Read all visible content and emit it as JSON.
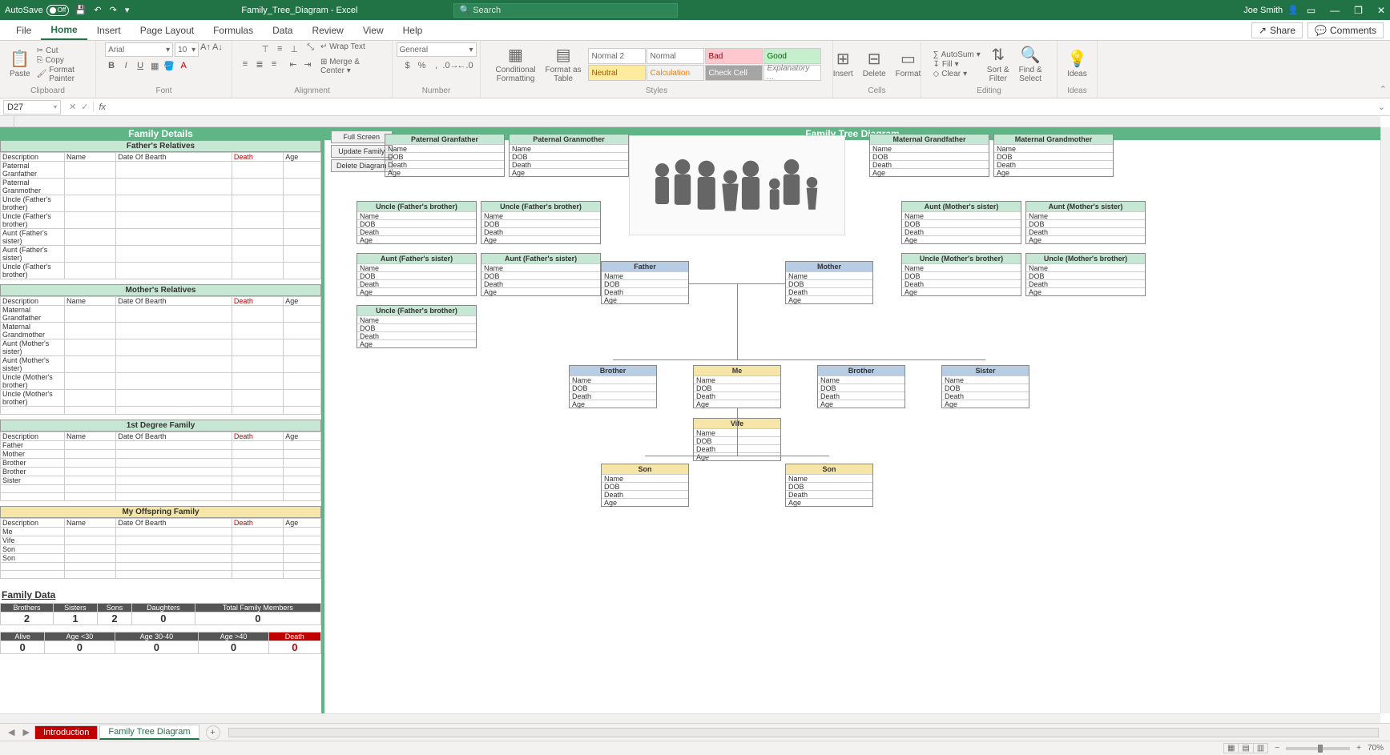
{
  "titlebar": {
    "autosave_label": "AutoSave",
    "autosave_state": "Off",
    "doc_title": "Family_Tree_Diagram - Excel",
    "search_placeholder": "Search",
    "user_name": "Joe Smith"
  },
  "menu": {
    "tabs": [
      "File",
      "Home",
      "Insert",
      "Page Layout",
      "Formulas",
      "Data",
      "Review",
      "View",
      "Help"
    ],
    "active": "Home",
    "share": "Share",
    "comments": "Comments"
  },
  "ribbon": {
    "clipboard": {
      "label": "Clipboard",
      "paste": "Paste",
      "cut": "Cut",
      "copy": "Copy",
      "format_painter": "Format Painter"
    },
    "font": {
      "label": "Font",
      "name": "Arial",
      "size": "10"
    },
    "alignment": {
      "label": "Alignment",
      "wrap": "Wrap Text",
      "merge": "Merge & Center"
    },
    "number": {
      "label": "Number",
      "format": "General"
    },
    "styles": {
      "label": "Styles",
      "cond": "Conditional\nFormatting",
      "table": "Format as\nTable",
      "cells": [
        "Normal 2",
        "Normal",
        "Bad",
        "Good",
        "Neutral",
        "Calculation",
        "Check Cell",
        "Explanatory ..."
      ]
    },
    "cells": {
      "label": "Cells",
      "insert": "Insert",
      "delete": "Delete",
      "format": "Format"
    },
    "editing": {
      "label": "Editing",
      "autosum": "AutoSum",
      "fill": "Fill",
      "clear": "Clear",
      "sort": "Sort &\nFilter",
      "find": "Find &\nSelect"
    },
    "ideas": {
      "label": "Ideas",
      "btn": "Ideas"
    }
  },
  "formula": {
    "cell_ref": "D27",
    "value": ""
  },
  "leftpanel": {
    "title": "Family Details",
    "cols": {
      "desc": "Description",
      "name": "Name",
      "dob": "Date Of Bearth",
      "death": "Death",
      "age": "Age"
    },
    "father_hdr": "Father's Relatives",
    "father_rows": [
      "Paternal Granfather",
      "Paternal Granmother",
      "Uncle (Father's brother)",
      "Uncle (Father's brother)",
      "Aunt (Father's sister)",
      "Aunt (Father's sister)",
      "Uncle (Father's brother)"
    ],
    "mother_hdr": "Mother's Relatives",
    "mother_rows": [
      "Maternal Grandfather",
      "Maternal Grandmother",
      "Aunt (Mother's sister)",
      "Aunt (Mother's sister)",
      "Uncle (Mother's brother)",
      "Uncle (Mother's brother)"
    ],
    "first_hdr": "1st Degree Family",
    "first_rows": [
      "Father",
      "Mother",
      "Brother",
      "Brother",
      "Sister"
    ],
    "offspring_hdr": "My Offspring Family",
    "offspring_rows": [
      "Me",
      "Vife",
      "Son",
      "Son"
    ],
    "family_data": "Family Data",
    "stats1": {
      "hdrs": [
        "Brothers",
        "Sisters",
        "Sons",
        "Daughters",
        "Total Family Members"
      ],
      "vals": [
        "2",
        "1",
        "2",
        "0",
        "0"
      ]
    },
    "stats2": {
      "hdrs": [
        "Alive",
        "Age <30",
        "Age 30-40",
        "Age >40",
        "Death"
      ],
      "vals": [
        "0",
        "0",
        "0",
        "0",
        "0"
      ]
    }
  },
  "diagram": {
    "title": "Family Tree Diagram",
    "btns": {
      "full": "Full Screen",
      "update": "Update Family",
      "delete": "Delete Diagram"
    },
    "fields": [
      "Name",
      "DOB",
      "Death",
      "Age"
    ],
    "nodes": {
      "pg": "Paternal Granfather",
      "pm": "Paternal Granmother",
      "mg": "Maternal Grandfather",
      "mm": "Maternal Grandmother",
      "ufb1": "Uncle (Father's brother)",
      "ufb2": "Uncle (Father's brother)",
      "ufb3": "Uncle (Father's brother)",
      "afs1": "Aunt (Father's sister)",
      "afs2": "Aunt (Father's sister)",
      "ams1": "Aunt (Mother's sister)",
      "ams2": "Aunt (Mother's sister)",
      "umb1": "Uncle (Mother's brother)",
      "umb2": "Uncle (Mother's brother)",
      "father": "Father",
      "mother": "Mother",
      "brother1": "Brother",
      "me": "Me",
      "brother2": "Brother",
      "sister": "Sister",
      "wife": "Vife",
      "son1": "Son",
      "son2": "Son"
    }
  },
  "sheettabs": {
    "intro": "Introduction",
    "ftd": "Family Tree Diagram"
  },
  "statusbar": {
    "zoom": "70%"
  }
}
